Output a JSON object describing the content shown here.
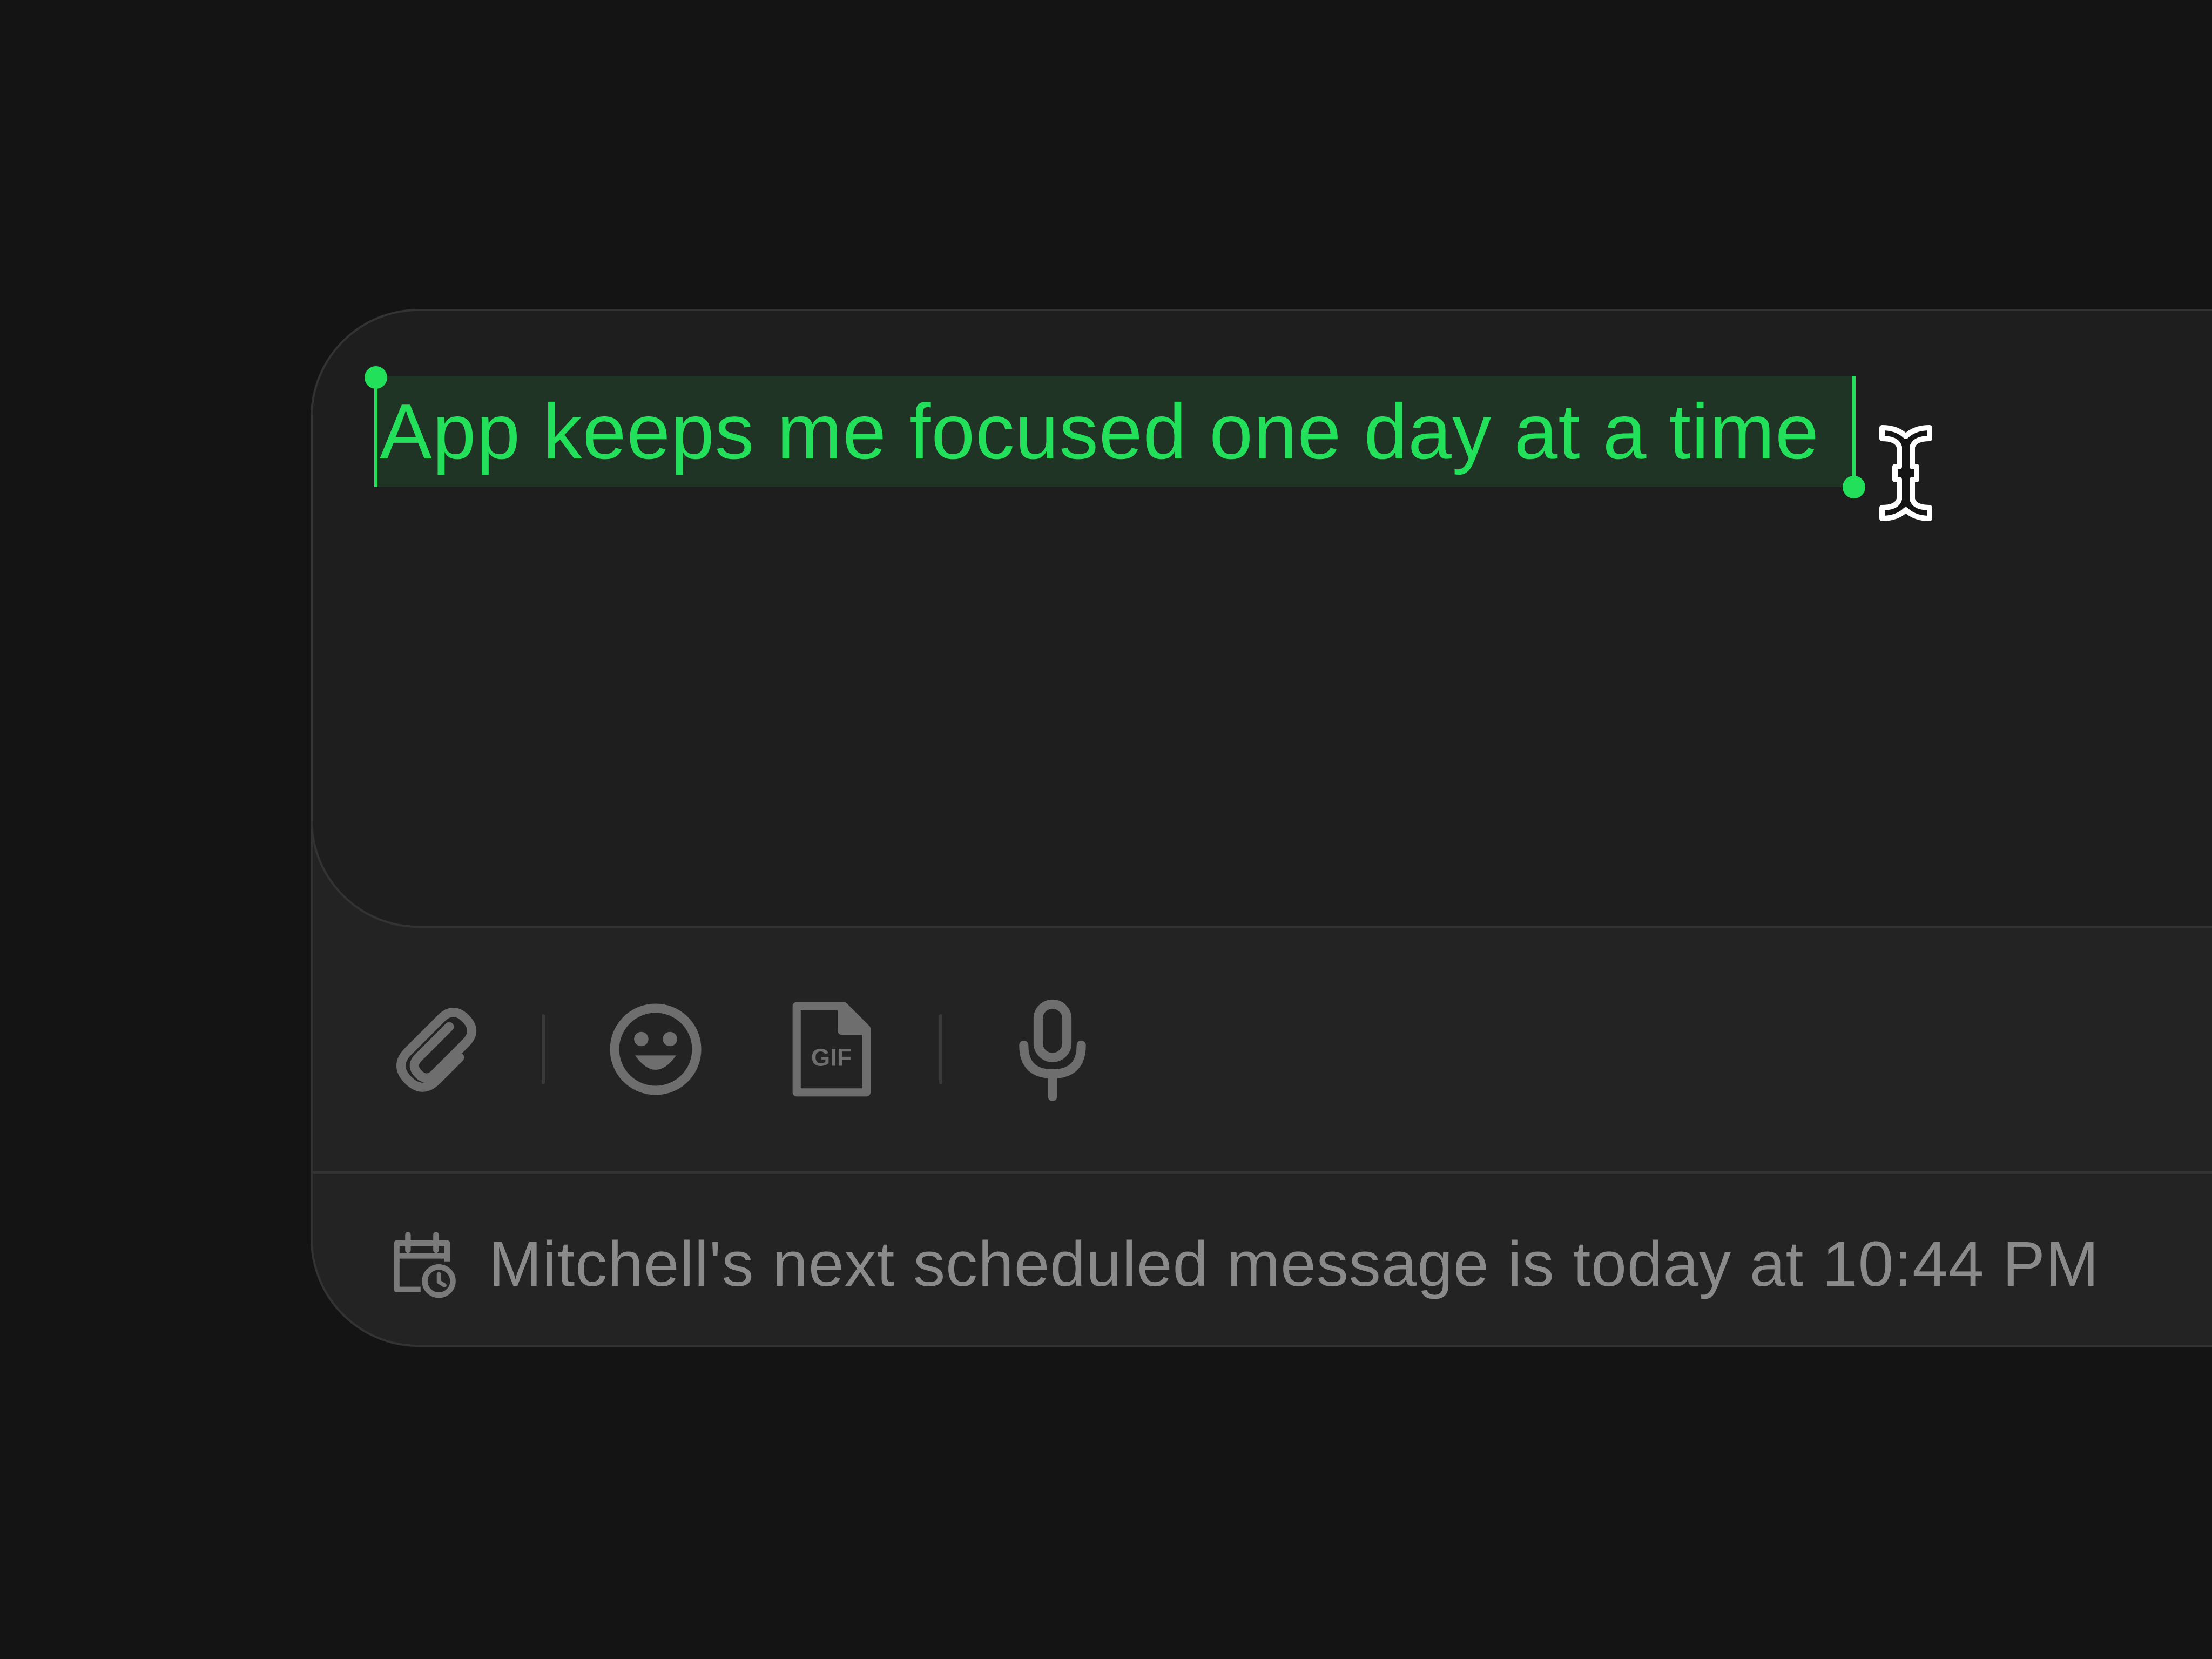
{
  "editor": {
    "message": "App keeps me focused one day at a time",
    "selection_color": "#22e05a"
  },
  "toolbar": {
    "icons": [
      "paperclip-icon",
      "emoji-icon",
      "gif-icon",
      "microphone-icon"
    ]
  },
  "footer": {
    "schedule_text": "Mitchell's next scheduled message is today at 10:44 PM",
    "icon": "calendar-clock-icon"
  },
  "colors": {
    "background": "#141414",
    "accent": "#22e05a",
    "muted_text": "#8a8a8a"
  }
}
